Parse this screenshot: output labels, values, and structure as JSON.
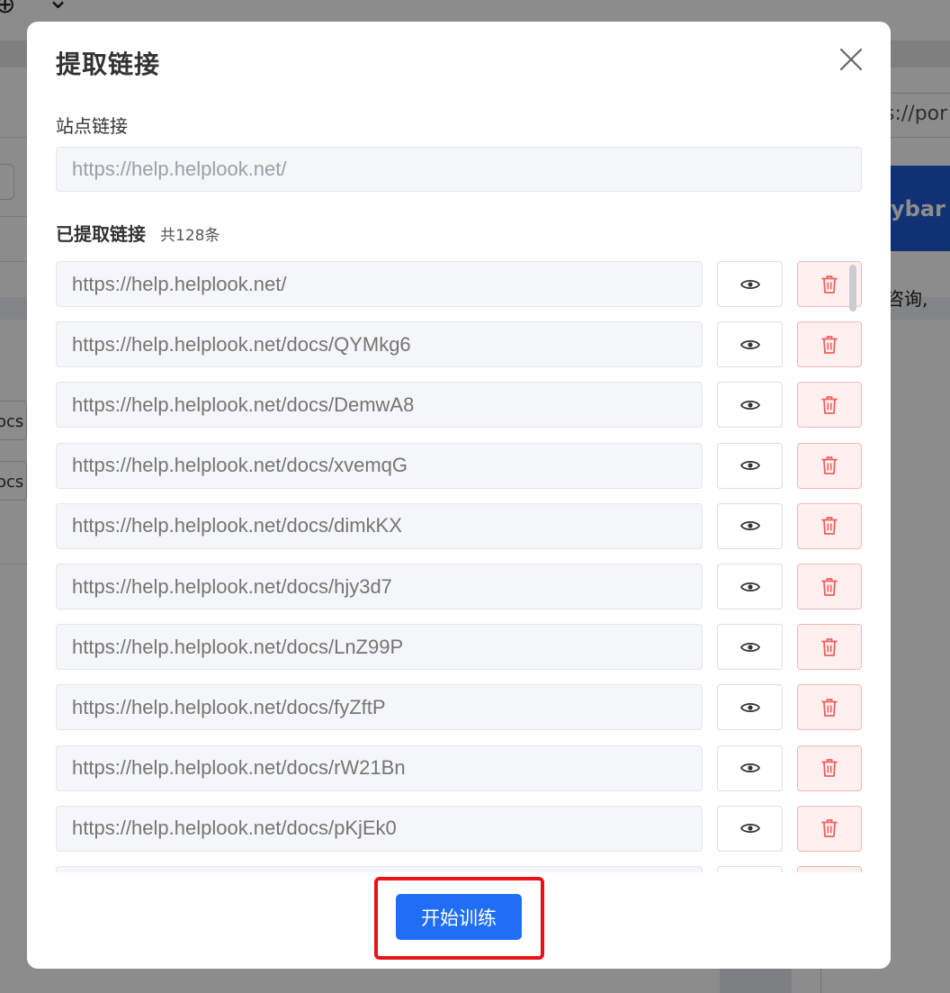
{
  "background": {
    "right_input_text": "s://por",
    "banner_text": "ybar",
    "right_text": "咨询,",
    "left_tags": [
      "ocs",
      "ocs"
    ]
  },
  "modal": {
    "title": "提取链接",
    "close_icon": "close-icon",
    "site_link": {
      "label": "站点链接",
      "placeholder": "https://help.helplook.net/"
    },
    "extracted": {
      "title": "已提取链接",
      "count": "共128条"
    },
    "links": [
      "https://help.helplook.net/",
      "https://help.helplook.net/docs/QYMkg6",
      "https://help.helplook.net/docs/DemwA8",
      "https://help.helplook.net/docs/xvemqG",
      "https://help.helplook.net/docs/dimkKX",
      "https://help.helplook.net/docs/hjy3d7",
      "https://help.helplook.net/docs/LnZ99P",
      "https://help.helplook.net/docs/fyZftP",
      "https://help.helplook.net/docs/rW21Bn",
      "https://help.helplook.net/docs/pKjEk0",
      ""
    ],
    "start_button": "开始训练"
  },
  "colors": {
    "primary": "#1f6ef5",
    "danger": "#f25f5c",
    "danger_bg": "#fff0f0",
    "highlight": "#e8121a"
  }
}
